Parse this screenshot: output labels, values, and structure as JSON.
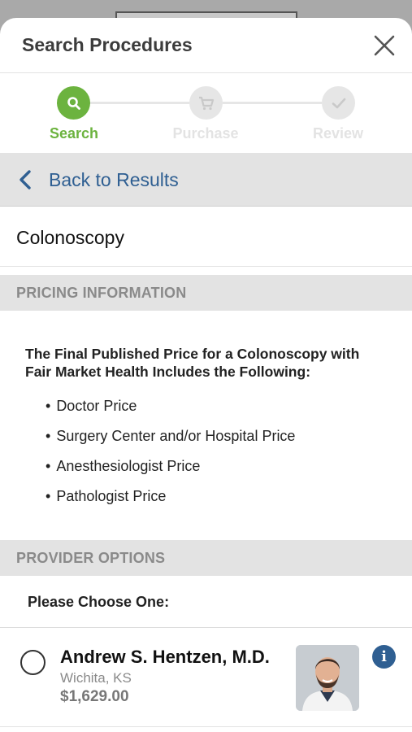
{
  "header": {
    "title": "Search Procedures"
  },
  "stepper": {
    "steps": [
      {
        "label": "Search",
        "icon": "search-icon",
        "active": true
      },
      {
        "label": "Purchase",
        "icon": "cart-icon",
        "active": false
      },
      {
        "label": "Review",
        "icon": "check-icon",
        "active": false
      }
    ],
    "active_color": "#6cb33f",
    "inactive_color": "#e6e6e6"
  },
  "back": {
    "label": "Back to Results"
  },
  "procedure": {
    "name": "Colonoscopy"
  },
  "pricing": {
    "section_title": "PRICING INFORMATION",
    "intro_line1": "The Final Published Price for a Colonoscopy with",
    "intro_line2": "Fair Market Health Includes the Following:",
    "items": [
      "Doctor Price",
      "Surgery Center and/or Hospital Price",
      "Anesthesiologist Price",
      "Pathologist Price"
    ]
  },
  "providers": {
    "section_title": "PROVIDER OPTIONS",
    "prompt": "Please Choose One:",
    "list": [
      {
        "name": "Andrew S. Hentzen, M.D.",
        "location": "Wichita, KS",
        "price": "$1,629.00"
      }
    ]
  },
  "colors": {
    "accent_blue": "#2f5f92",
    "section_bg": "#e3e3e3"
  }
}
